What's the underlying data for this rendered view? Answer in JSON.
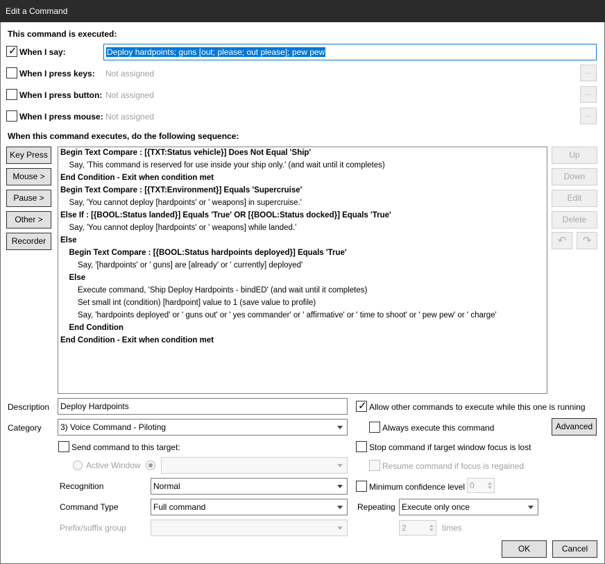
{
  "window": {
    "title": "Edit a Command"
  },
  "triggers": {
    "heading": "This command is executed:",
    "say": {
      "label": "When I say:",
      "value": "Deploy hardpoints; guns [out; please; out please]; pew pew",
      "checked": true
    },
    "keys": {
      "label": "When I press keys:",
      "value": "Not assigned",
      "button": "..."
    },
    "button": {
      "label": "When I press button:",
      "value": "Not assigned",
      "button": "..."
    },
    "mouse": {
      "label": "When I press mouse:",
      "value": "Not assigned",
      "button": "..."
    }
  },
  "sequence": {
    "heading": "When this command executes, do the following sequence:",
    "left_buttons": [
      "Key Press",
      "Mouse >",
      "Pause >",
      "Other >",
      "Recorder"
    ],
    "right_buttons": [
      "Up",
      "Down",
      "Edit",
      "Delete"
    ],
    "undo_icon": "undo-arrow",
    "redo_icon": "redo-arrow",
    "lines": [
      {
        "text": "Begin Text Compare : [{TXT:Status vehicle}] Does Not Equal 'Ship'",
        "bold": true,
        "indent": 0
      },
      {
        "text": "Say, 'This command is reserved for use inside your ship only.'  (and wait until it completes)",
        "bold": false,
        "indent": 1
      },
      {
        "text": "End Condition - Exit when condition met",
        "bold": true,
        "indent": 0
      },
      {
        "text": "Begin Text Compare : [{TXT:Environment}] Equals 'Supercruise'",
        "bold": true,
        "indent": 0
      },
      {
        "text": "Say, 'You cannot deploy [hardpoints' or ' weapons] in supercruise.'",
        "bold": false,
        "indent": 1
      },
      {
        "text": "Else If : [{BOOL:Status landed}] Equals 'True' OR [{BOOL:Status docked}] Equals 'True'",
        "bold": true,
        "indent": 0
      },
      {
        "text": "Say, 'You cannot deploy [hardpoints' or ' weapons] while landed.'",
        "bold": false,
        "indent": 1
      },
      {
        "text": "Else",
        "bold": true,
        "indent": 0
      },
      {
        "text": "Begin Text Compare : [{BOOL:Status hardpoints deployed}] Equals 'True'",
        "bold": true,
        "indent": 1
      },
      {
        "text": "Say, '[hardpoints' or ' guns] are [already' or ' currently] deployed'",
        "bold": false,
        "indent": 2
      },
      {
        "text": "Else",
        "bold": true,
        "indent": 1
      },
      {
        "text": "Execute command, 'Ship Deploy Hardpoints - bindED' (and wait until it completes)",
        "bold": false,
        "indent": 2
      },
      {
        "text": "Set small int (condition) [hardpoint] value to 1 (save value to profile)",
        "bold": false,
        "indent": 2
      },
      {
        "text": "Say, 'hardpoints deployed' or ' guns out' or ' yes commander' or ' affirmative' or ' time to shoot' or ' pew pew' or ' charge'",
        "bold": false,
        "indent": 2
      },
      {
        "text": "End Condition",
        "bold": true,
        "indent": 1
      },
      {
        "text": "End Condition - Exit when condition met",
        "bold": true,
        "indent": 0
      }
    ]
  },
  "settings": {
    "description": {
      "label": "Description",
      "value": "Deploy Hardpoints"
    },
    "category": {
      "label": "Category",
      "value": "3) Voice Command - Piloting"
    },
    "send_target": {
      "label": "Send command to this target:",
      "checked": false
    },
    "active_window": {
      "label": "Active Window"
    },
    "target_combo": {
      "value": ""
    },
    "recognition": {
      "label": "Recognition",
      "value": "Normal"
    },
    "command_type": {
      "label": "Command Type",
      "value": "Full command"
    },
    "prefix_suffix": {
      "label": "Prefix/suffix group",
      "value": ""
    },
    "allow_other": {
      "label": "Allow other commands to execute while this one is running",
      "checked": true
    },
    "always_execute": {
      "label": "Always execute this command",
      "checked": false
    },
    "advanced_button": "Advanced",
    "stop_on_focus": {
      "label": "Stop command if target window focus is lost",
      "checked": false
    },
    "resume_on_focus": {
      "label": "Resume command if focus is regained",
      "checked": false
    },
    "min_confidence": {
      "label": "Minimum confidence level",
      "checked": false,
      "value": "0"
    },
    "repeating": {
      "label": "Repeating",
      "value": "Execute only once"
    },
    "times": {
      "value": "2",
      "label": "times"
    }
  },
  "footer": {
    "ok": "OK",
    "cancel": "Cancel"
  }
}
